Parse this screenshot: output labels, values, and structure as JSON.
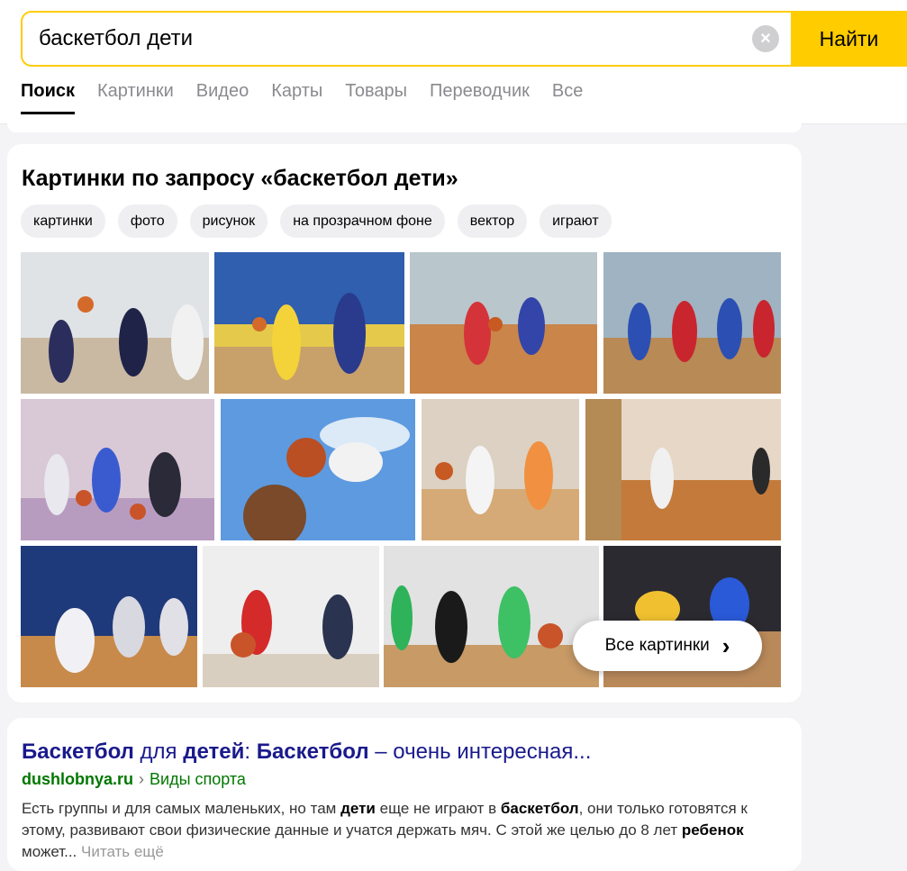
{
  "search": {
    "query": "баскетбол дети",
    "submit_label": "Найти",
    "clear_glyph": "×"
  },
  "tabs": [
    {
      "label": "Поиск",
      "active": true
    },
    {
      "label": "Картинки",
      "active": false
    },
    {
      "label": "Видео",
      "active": false
    },
    {
      "label": "Карты",
      "active": false
    },
    {
      "label": "Товары",
      "active": false
    },
    {
      "label": "Переводчик",
      "active": false
    },
    {
      "label": "Все",
      "active": false
    }
  ],
  "images_block": {
    "title": "Картинки по запросу «баскетбол дети»",
    "chips": [
      "картинки",
      "фото",
      "рисунок",
      "на прозрачном фоне",
      "вектор",
      "играют"
    ],
    "all_images_label": "Все картинки",
    "chevron_icon": "chevron-right-icon"
  },
  "result": {
    "title_parts": [
      {
        "text": "Баскетбол",
        "bold": true
      },
      {
        "text": " для ",
        "bold": false
      },
      {
        "text": "детей",
        "bold": true
      },
      {
        "text": ": ",
        "bold": false
      },
      {
        "text": "Баскетбол",
        "bold": true
      },
      {
        "text": " – очень интересная...",
        "bold": false
      }
    ],
    "domain": "dushlobnya.ru",
    "separator": "›",
    "path": "Виды спорта",
    "snippet_parts": [
      {
        "text": "Есть группы и для самых маленьких, но там ",
        "bold": false
      },
      {
        "text": "дети",
        "bold": true
      },
      {
        "text": " еще не играют в ",
        "bold": false
      },
      {
        "text": "баскетбол",
        "bold": true
      },
      {
        "text": ", они только готовятся к этому, развивают свои физические данные и учатся держать мяч. С этой же целью до 8 лет ",
        "bold": false
      },
      {
        "text": "ребенок",
        "bold": true
      },
      {
        "text": " может... ",
        "bold": false
      }
    ],
    "read_more": "Читать ещё"
  },
  "colors": {
    "accent_yellow": "#ffcc00",
    "link_title": "#1a1a8c",
    "url_green": "#007700"
  }
}
